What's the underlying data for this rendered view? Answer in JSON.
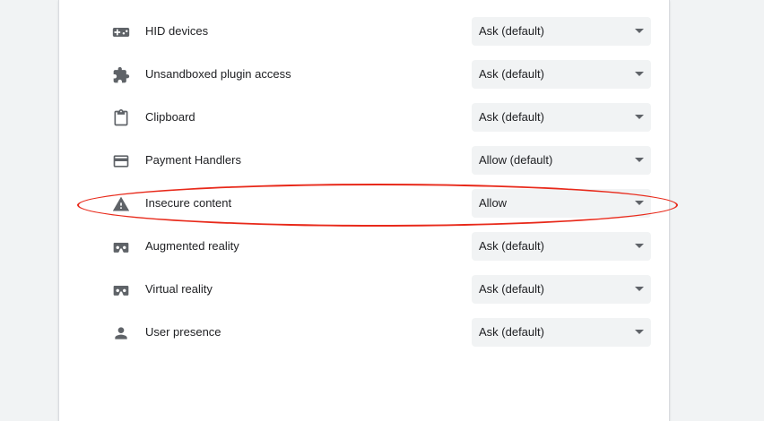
{
  "settings": {
    "rows": [
      {
        "label": "HID devices",
        "value": "Ask (default)",
        "icon": "gamepad-icon"
      },
      {
        "label": "Unsandboxed plugin access",
        "value": "Ask (default)",
        "icon": "puzzle-piece-icon"
      },
      {
        "label": "Clipboard",
        "value": "Ask (default)",
        "icon": "clipboard-icon"
      },
      {
        "label": "Payment Handlers",
        "value": "Allow (default)",
        "icon": "credit-card-icon"
      },
      {
        "label": "Insecure content",
        "value": "Allow",
        "icon": "warning-icon"
      },
      {
        "label": "Augmented reality",
        "value": "Ask (default)",
        "icon": "vr-headset-icon"
      },
      {
        "label": "Virtual reality",
        "value": "Ask (default)",
        "icon": "vr-headset-icon"
      },
      {
        "label": "User presence",
        "value": "Ask (default)",
        "icon": "person-icon"
      }
    ]
  },
  "annotation": {
    "color": "#e8291a",
    "highlighted_row": "Insecure content"
  },
  "colors": {
    "page_background": "#f1f3f4",
    "card_background": "#ffffff",
    "select_background": "#f1f3f4",
    "icon": "#5f6368",
    "text": "#202124"
  }
}
